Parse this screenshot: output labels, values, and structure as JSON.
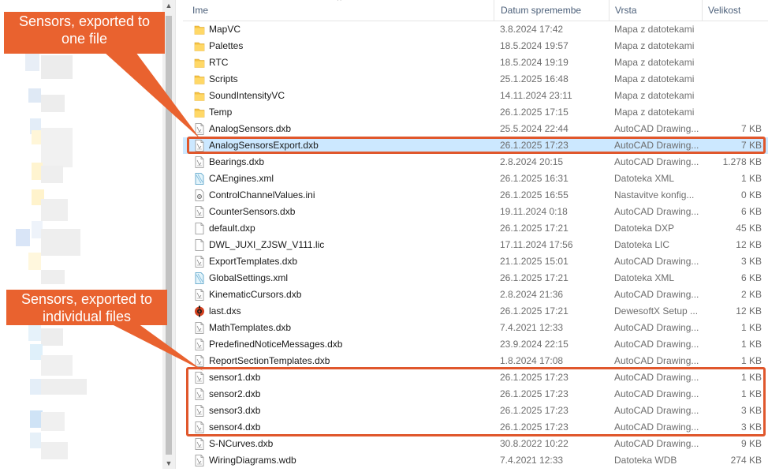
{
  "columns": {
    "name": "Ime",
    "date": "Datum spremembe",
    "type": "Vrsta",
    "size": "Velikost"
  },
  "files": [
    {
      "name": "MapVC",
      "date": "3.8.2024 17:42",
      "type": "Mapa z datotekami",
      "size": "",
      "icon": "folder-icon"
    },
    {
      "name": "Palettes",
      "date": "18.5.2024 19:57",
      "type": "Mapa z datotekami",
      "size": "",
      "icon": "folder-icon"
    },
    {
      "name": "RTC",
      "date": "18.5.2024 19:19",
      "type": "Mapa z datotekami",
      "size": "",
      "icon": "folder-icon"
    },
    {
      "name": "Scripts",
      "date": "25.1.2025 16:48",
      "type": "Mapa z datotekami",
      "size": "",
      "icon": "folder-icon"
    },
    {
      "name": "SoundIntensityVC",
      "date": "14.11.2024 23:11",
      "type": "Mapa z datotekami",
      "size": "",
      "icon": "folder-icon"
    },
    {
      "name": "Temp",
      "date": "26.1.2025 17:15",
      "type": "Mapa z datotekami",
      "size": "",
      "icon": "folder-icon"
    },
    {
      "name": "AnalogSensors.dxb",
      "date": "25.5.2024 22:44",
      "type": "AutoCAD Drawing...",
      "size": "7 KB",
      "icon": "document-icon"
    },
    {
      "name": "AnalogSensorsExport.dxb",
      "date": "26.1.2025 17:23",
      "type": "AutoCAD Drawing...",
      "size": "7 KB",
      "icon": "document-icon"
    },
    {
      "name": "Bearings.dxb",
      "date": "2.8.2024 20:15",
      "type": "AutoCAD Drawing...",
      "size": "1.278 KB",
      "icon": "document-icon"
    },
    {
      "name": "CAEngines.xml",
      "date": "26.1.2025 16:31",
      "type": "Datoteka XML",
      "size": "1 KB",
      "icon": "xml-icon"
    },
    {
      "name": "ControlChannelValues.ini",
      "date": "26.1.2025 16:55",
      "type": "Nastavitve konfig...",
      "size": "0 KB",
      "icon": "settings-file-icon"
    },
    {
      "name": "CounterSensors.dxb",
      "date": "19.11.2024 0:18",
      "type": "AutoCAD Drawing...",
      "size": "6 KB",
      "icon": "document-icon"
    },
    {
      "name": "default.dxp",
      "date": "26.1.2025 17:21",
      "type": "Datoteka DXP",
      "size": "45 KB",
      "icon": "blank-file-icon"
    },
    {
      "name": "DWL_JUXI_ZJSW_V111.lic",
      "date": "17.11.2024 17:56",
      "type": "Datoteka LIC",
      "size": "12 KB",
      "icon": "blank-file-icon"
    },
    {
      "name": "ExportTemplates.dxb",
      "date": "21.1.2025 15:01",
      "type": "AutoCAD Drawing...",
      "size": "3 KB",
      "icon": "document-icon"
    },
    {
      "name": "GlobalSettings.xml",
      "date": "26.1.2025 17:21",
      "type": "Datoteka XML",
      "size": "6 KB",
      "icon": "xml-icon"
    },
    {
      "name": "KinematicCursors.dxb",
      "date": "2.8.2024 21:36",
      "type": "AutoCAD Drawing...",
      "size": "2 KB",
      "icon": "document-icon"
    },
    {
      "name": "last.dxs",
      "date": "26.1.2025 17:21",
      "type": "DewesoftX Setup ...",
      "size": "12 KB",
      "icon": "dewesoft-setup-icon"
    },
    {
      "name": "MathTemplates.dxb",
      "date": "7.4.2021 12:33",
      "type": "AutoCAD Drawing...",
      "size": "1 KB",
      "icon": "document-icon"
    },
    {
      "name": "PredefinedNoticeMessages.dxb",
      "date": "23.9.2024 22:15",
      "type": "AutoCAD Drawing...",
      "size": "1 KB",
      "icon": "document-icon"
    },
    {
      "name": "ReportSectionTemplates.dxb",
      "date": "1.8.2024 17:08",
      "type": "AutoCAD Drawing...",
      "size": "1 KB",
      "icon": "document-icon"
    },
    {
      "name": "sensor1.dxb",
      "date": "26.1.2025 17:23",
      "type": "AutoCAD Drawing...",
      "size": "1 KB",
      "icon": "document-icon"
    },
    {
      "name": "sensor2.dxb",
      "date": "26.1.2025 17:23",
      "type": "AutoCAD Drawing...",
      "size": "1 KB",
      "icon": "document-icon"
    },
    {
      "name": "sensor3.dxb",
      "date": "26.1.2025 17:23",
      "type": "AutoCAD Drawing...",
      "size": "3 KB",
      "icon": "document-icon"
    },
    {
      "name": "sensor4.dxb",
      "date": "26.1.2025 17:23",
      "type": "AutoCAD Drawing...",
      "size": "3 KB",
      "icon": "document-icon"
    },
    {
      "name": "S-NCurves.dxb",
      "date": "30.8.2022 10:22",
      "type": "AutoCAD Drawing...",
      "size": "9 KB",
      "icon": "document-icon"
    },
    {
      "name": "WiringDiagrams.wdb",
      "date": "7.4.2021 12:33",
      "type": "Datoteka WDB",
      "size": "274 KB",
      "icon": "document-icon"
    }
  ],
  "selected_file": "AnalogSensorsExport.dxb",
  "callouts": {
    "top": {
      "line1": "Sensors, exported to",
      "line2": "one file"
    },
    "bottom": {
      "line1": "Sensors, exported to",
      "line2": "individual files"
    }
  },
  "colors": {
    "callout": "#e9622f",
    "highlight_border": "#e0572c",
    "selection": "#cce8ff",
    "folder": "#f5c242",
    "header_text": "#4c607a"
  }
}
